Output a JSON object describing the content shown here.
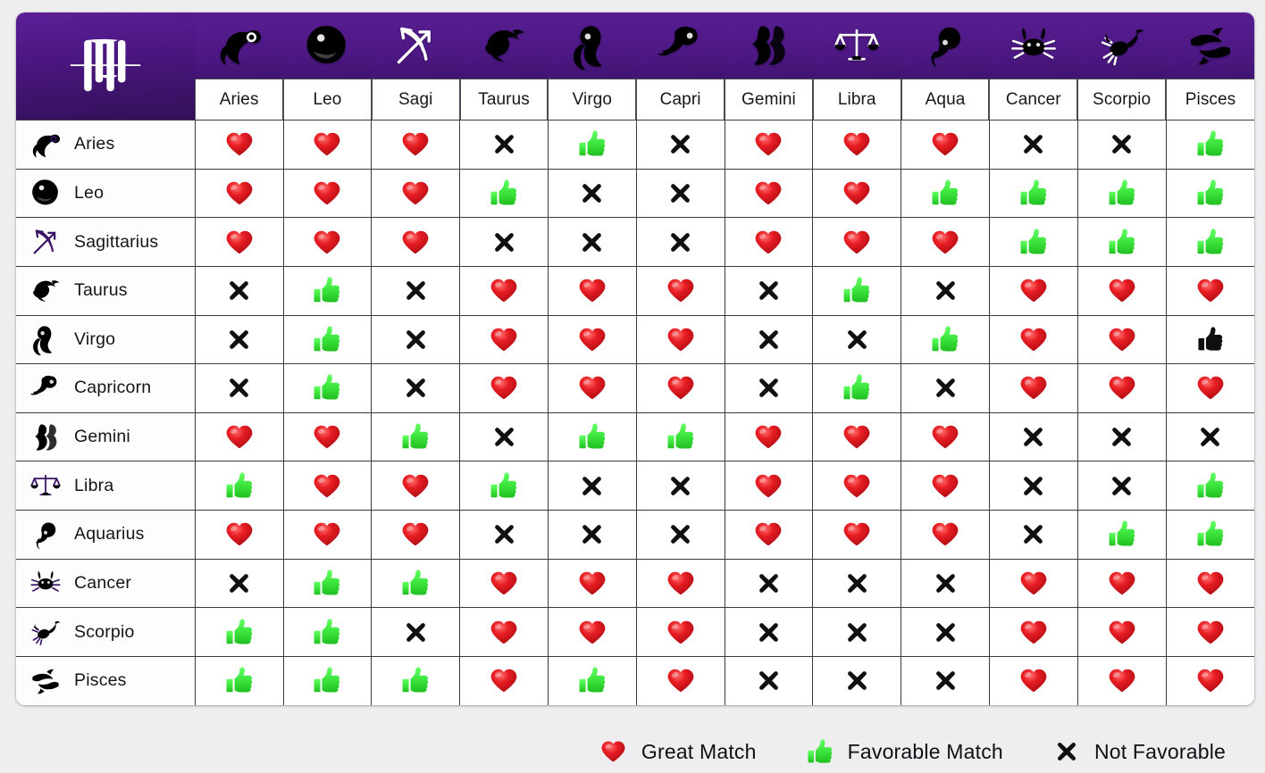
{
  "title": "Zodiac Compatibility Chart",
  "theme": {
    "header_purple_light": "#5c1f96",
    "header_purple_dark": "#2e0d52",
    "page_background": "#eeeef1",
    "cell_background": "#ffffff",
    "grid_line": "#3a3a44",
    "heart_red": "#e01b22",
    "thumb_green": "#3ce83c",
    "cross_black": "#111111",
    "sign_icon_purple": "#3b1467"
  },
  "corner": {
    "logo_icon": "astrology-monogram-icon",
    "label": ""
  },
  "columns": [
    {
      "key": "aries",
      "label": "Aries",
      "icon": "aries-ram-icon"
    },
    {
      "key": "leo",
      "label": "Leo",
      "icon": "leo-lion-icon"
    },
    {
      "key": "sagi",
      "label": "Sagi",
      "icon": "sagittarius-bow-icon"
    },
    {
      "key": "taurus",
      "label": "Taurus",
      "icon": "taurus-bull-icon"
    },
    {
      "key": "virgo",
      "label": "Virgo",
      "icon": "virgo-maiden-icon"
    },
    {
      "key": "capri",
      "label": "Capri",
      "icon": "capricorn-goat-icon"
    },
    {
      "key": "gemini",
      "label": "Gemini",
      "icon": "gemini-twins-icon"
    },
    {
      "key": "libra",
      "label": "Libra",
      "icon": "libra-scales-icon"
    },
    {
      "key": "aqua",
      "label": "Aqua",
      "icon": "aquarius-waterbearer-icon"
    },
    {
      "key": "cancer",
      "label": "Cancer",
      "icon": "cancer-crab-icon"
    },
    {
      "key": "scorpio",
      "label": "Scorpio",
      "icon": "scorpio-scorpion-icon"
    },
    {
      "key": "pisces",
      "label": "Pisces",
      "icon": "pisces-fish-icon"
    }
  ],
  "rows": [
    {
      "key": "aries",
      "label": "Aries",
      "icon": "aries-ram-icon",
      "values": [
        "heart",
        "heart",
        "heart",
        "cross",
        "thumb",
        "cross",
        "heart",
        "heart",
        "heart",
        "cross",
        "cross",
        "thumb"
      ]
    },
    {
      "key": "leo",
      "label": "Leo",
      "icon": "leo-lion-icon",
      "values": [
        "heart",
        "heart",
        "heart",
        "thumb",
        "cross",
        "cross",
        "heart",
        "heart",
        "thumb",
        "thumb",
        "thumb",
        "thumb"
      ]
    },
    {
      "key": "sagittarius",
      "label": "Sagittarius",
      "icon": "sagittarius-bow-icon",
      "values": [
        "heart",
        "heart",
        "heart",
        "cross",
        "cross",
        "cross",
        "heart",
        "heart",
        "heart",
        "thumb",
        "thumb",
        "thumb"
      ]
    },
    {
      "key": "taurus",
      "label": "Taurus",
      "icon": "taurus-bull-icon",
      "values": [
        "cross",
        "thumb",
        "cross",
        "heart",
        "heart",
        "heart",
        "cross",
        "thumb",
        "cross",
        "heart",
        "heart",
        "heart"
      ]
    },
    {
      "key": "virgo",
      "label": "Virgo",
      "icon": "virgo-maiden-icon",
      "values": [
        "cross",
        "thumb",
        "cross",
        "heart",
        "heart",
        "heart",
        "cross",
        "cross",
        "thumb",
        "heart",
        "heart",
        "thumb-black"
      ]
    },
    {
      "key": "capricorn",
      "label": "Capricorn",
      "icon": "capricorn-goat-icon",
      "values": [
        "cross",
        "thumb",
        "cross",
        "heart",
        "heart",
        "heart",
        "cross",
        "thumb",
        "cross",
        "heart",
        "heart",
        "heart"
      ]
    },
    {
      "key": "gemini",
      "label": "Gemini",
      "icon": "gemini-twins-icon",
      "values": [
        "heart",
        "heart",
        "thumb",
        "cross",
        "thumb",
        "thumb",
        "heart",
        "heart",
        "heart",
        "cross",
        "cross",
        "cross"
      ]
    },
    {
      "key": "libra",
      "label": "Libra",
      "icon": "libra-scales-icon",
      "values": [
        "thumb",
        "heart",
        "heart",
        "thumb",
        "cross",
        "cross",
        "heart",
        "heart",
        "heart",
        "cross",
        "cross",
        "thumb"
      ]
    },
    {
      "key": "aquarius",
      "label": "Aquarius",
      "icon": "aquarius-waterbearer-icon",
      "values": [
        "heart",
        "heart",
        "heart",
        "cross",
        "cross",
        "cross",
        "heart",
        "heart",
        "heart",
        "cross",
        "thumb",
        "thumb"
      ]
    },
    {
      "key": "cancer",
      "label": "Cancer",
      "icon": "cancer-crab-icon",
      "values": [
        "cross",
        "thumb",
        "thumb",
        "heart",
        "heart",
        "heart",
        "cross",
        "cross",
        "cross",
        "heart",
        "heart",
        "heart"
      ]
    },
    {
      "key": "scorpio",
      "label": "Scorpio",
      "icon": "scorpio-scorpion-icon",
      "values": [
        "thumb",
        "thumb",
        "cross",
        "heart",
        "heart",
        "heart",
        "cross",
        "cross",
        "cross",
        "heart",
        "heart",
        "heart"
      ]
    },
    {
      "key": "pisces",
      "label": "Pisces",
      "icon": "pisces-fish-icon",
      "values": [
        "thumb",
        "thumb",
        "thumb",
        "heart",
        "thumb",
        "heart",
        "cross",
        "cross",
        "cross",
        "heart",
        "heart",
        "heart"
      ]
    }
  ],
  "legend": [
    {
      "key": "heart",
      "icon": "heart-icon",
      "label": "Great Match"
    },
    {
      "key": "thumb",
      "icon": "thumbs-up-icon",
      "label": "Favorable Match"
    },
    {
      "key": "cross",
      "icon": "cross-x-icon",
      "label": "Not Favorable"
    }
  ]
}
